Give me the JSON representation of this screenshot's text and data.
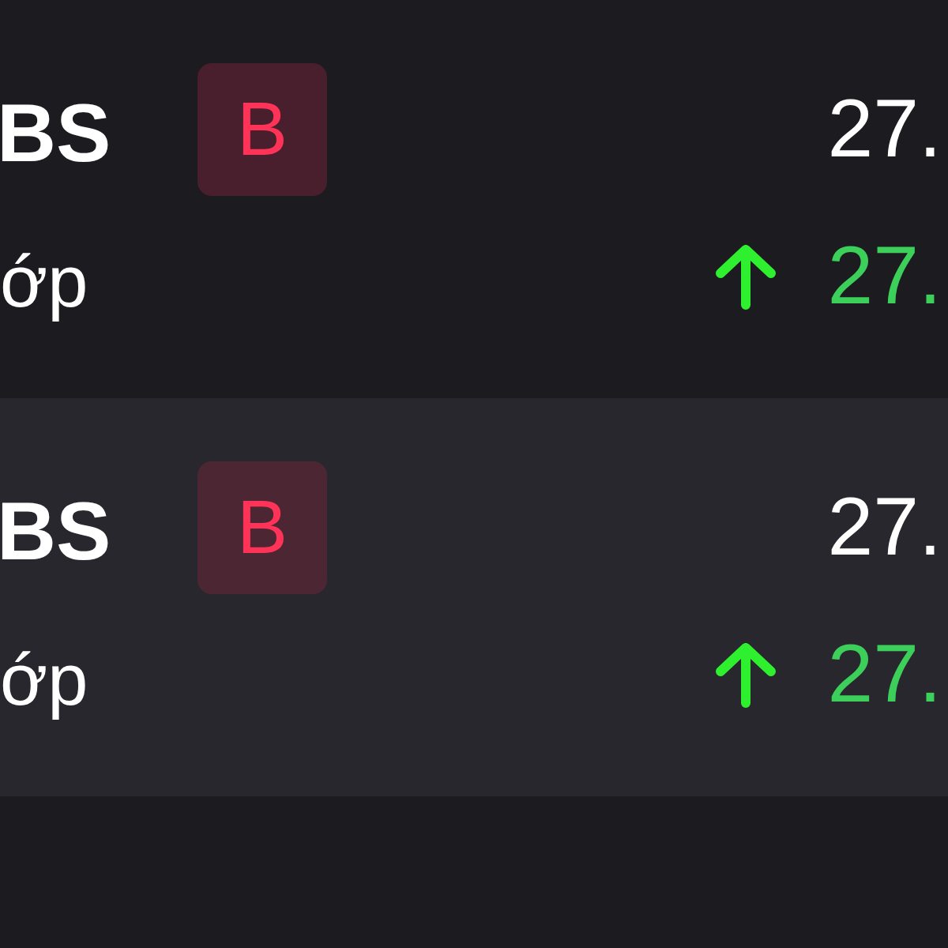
{
  "rows": [
    {
      "symbol": "BS",
      "subtitle": "ớp",
      "badge": "B",
      "price": "27.",
      "change": "27.",
      "up": true
    },
    {
      "symbol": "BS",
      "subtitle": "ớp",
      "badge": "B",
      "price": "27.",
      "change": "27.",
      "up": true
    }
  ]
}
